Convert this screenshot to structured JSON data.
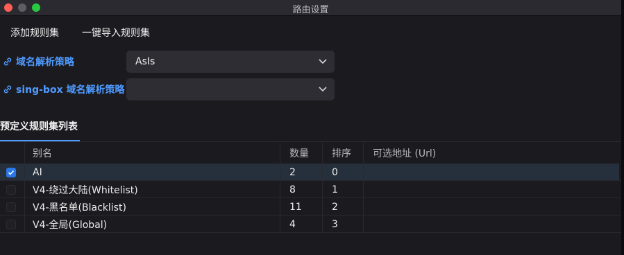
{
  "window": {
    "title": "路由设置"
  },
  "menu": {
    "add_ruleset": "添加规则集",
    "import_ruleset": "一键导入规则集"
  },
  "settings": {
    "dns_strategy_label": "域名解析策略",
    "dns_strategy_value": "AsIs",
    "singbox_dns_strategy_label": "sing-box 域名解析策略",
    "singbox_dns_strategy_value": ""
  },
  "tab": {
    "label": "预定义规则集列表"
  },
  "table": {
    "headers": {
      "alias": "别名",
      "count": "数量",
      "order": "排序",
      "url": "可选地址 (Url)"
    },
    "rows": [
      {
        "checked": true,
        "alias": "AI",
        "count": "2",
        "order": "0",
        "url": ""
      },
      {
        "checked": false,
        "alias": "V4-绕过大陆(Whitelist)",
        "count": "8",
        "order": "1",
        "url": ""
      },
      {
        "checked": false,
        "alias": "V4-黑名单(Blacklist)",
        "count": "11",
        "order": "2",
        "url": ""
      },
      {
        "checked": false,
        "alias": "V4-全局(Global)",
        "count": "4",
        "order": "3",
        "url": ""
      }
    ]
  },
  "colors": {
    "accent": "#4f9bff",
    "checkbox_checked": "#2a78e8",
    "background": "#1b1a1f"
  }
}
